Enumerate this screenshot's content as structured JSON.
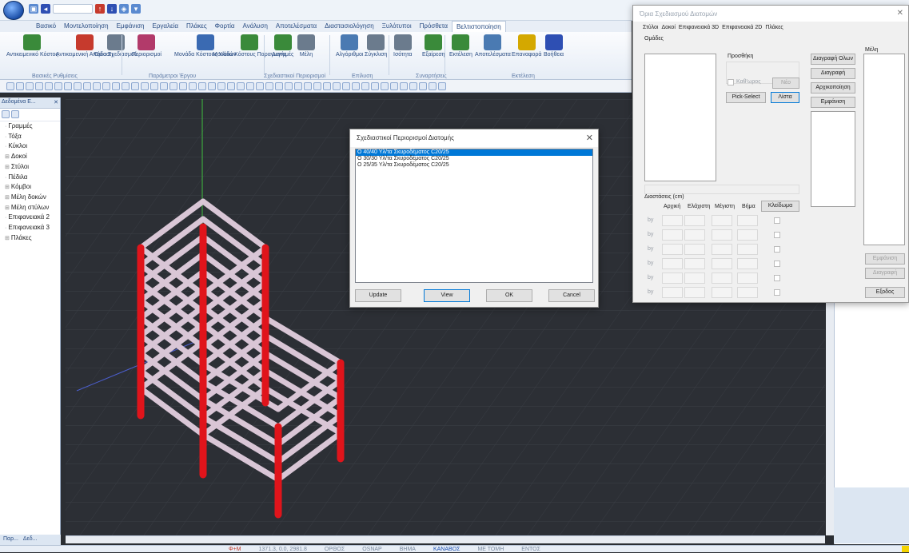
{
  "titlebar": {
    "qat_icons": [
      "save-icon",
      "undo-icon",
      "arrow-up-icon",
      "arrow-down-icon",
      "layers-icon",
      "dropdown-icon"
    ]
  },
  "tabs": [
    "Βασικό",
    "Μοντελοποίηση",
    "Εμφάνιση",
    "Εργαλεία",
    "Πλάκες",
    "Φορτία",
    "Ανάλυση",
    "Αποτελέσματα",
    "Διαστασιολόγηση",
    "Ξυλότυποι",
    "Πρόσθετα",
    "Βελτιστοποίηση"
  ],
  "ribbon": {
    "buttons": [
      "Αντικειμενικό Κόστος",
      "Αντικειμενική Απόδοση",
      "Όρια Σχεδιασμού",
      "Περιορισμοί",
      "Μονάδα Κόστους Υλικών",
      "Μονάδα Κόστους Παραγωγής",
      "Διατομές",
      "Μέλη",
      "Αλγόριθμοι",
      "Σύγκλιση",
      "Ισότητα",
      "Εξαίρεση",
      "Εκτέλεση",
      "Αποτελέσματα",
      "Επαναφορά",
      "Βοήθεια"
    ],
    "groups": [
      "Βασικές Ρυθμίσεις",
      "Παράμετροι Έργου",
      "Σχεδιαστικοί Περιορισμοί",
      "Επίλυση",
      "Συναρτήσεις",
      "Εκτέλεση"
    ]
  },
  "leftpane": {
    "title": "Δεδομένα Ε...",
    "tree": [
      "Γραμμές",
      "Τόξα",
      "Κύκλοι",
      "Δοκοί",
      "Στύλοι",
      "Πέδιλα",
      "Κόμβοι",
      "Μέλη δοκών",
      "Μέλη στύλων",
      "Επιφανειακά 2",
      "Επιφανειακά 3",
      "Πλάκες"
    ],
    "bottom_tabs": [
      "Παρ...",
      "Δεδ..."
    ]
  },
  "status": {
    "coords": "1371.3, 0.0, 2981.8",
    "items": [
      "ΟΡΘΟΣ",
      "OSNAP",
      "ΒΗΜΑ",
      "ΚΑΝΑΒΟΣ",
      "ΜΕ ΤΟΜΗ",
      "ΕΝΤΟΣ"
    ],
    "left": "Φ+Μ"
  },
  "dialog": {
    "title": "Σχεδιαστικοί Περιορισμοί Διατομής",
    "items": [
      "O 40/40 Υλ/τα Σκυροδέματος C20/25",
      "O 30/30 Υλ/τα Σκυροδέματος C20/25",
      "O 25/35 Υλ/τα Σκυροδέματος C20/25"
    ],
    "buttons": {
      "update": "Update",
      "view": "View",
      "ok": "OK",
      "cancel": "Cancel"
    }
  },
  "panel": {
    "title": "Όρια Σχεδιασμού Διατομών",
    "tabs": [
      "Στύλοι",
      "Δοκοί",
      "Επιφανειακά 3D",
      "Επιφανειακά 2D",
      "Πλάκες"
    ],
    "groups_label": "Ομάδες",
    "add_label": "Προσθήκη",
    "members_label": "Μέλη",
    "custom_label": "Καθ'ωρος",
    "new_btn": "Νέο",
    "pick_btn": "Pick-Select",
    "list_btn": "Λίστα",
    "delete_all_btn": "Διαγραφή Ολων",
    "delete_btn": "Διαγραφή",
    "init_btn": "Αρχικοποίηση",
    "show_btn": "Εμφάνιση",
    "members_show_btn": "Εμφάνιση",
    "members_delete_btn": "Διαγραφή",
    "exit_btn": "Εξοδος",
    "dims_label": "Διαστάσεις (cm)",
    "dim_cols": [
      "Αρχική",
      "Ελάχιστη",
      "Μέγιστη",
      "Βήμα"
    ],
    "lock_btn": "Κλείδωμα",
    "row_labels": [
      "by",
      "by",
      "by",
      "by",
      "by",
      "by"
    ]
  },
  "colors": {
    "column": "#e0141b",
    "beam": "#d9c6d6",
    "background": "#2c2f35",
    "axis_y": "#33bb33",
    "axis_x": "#4c5fd0",
    "selection": "#0078d7"
  }
}
